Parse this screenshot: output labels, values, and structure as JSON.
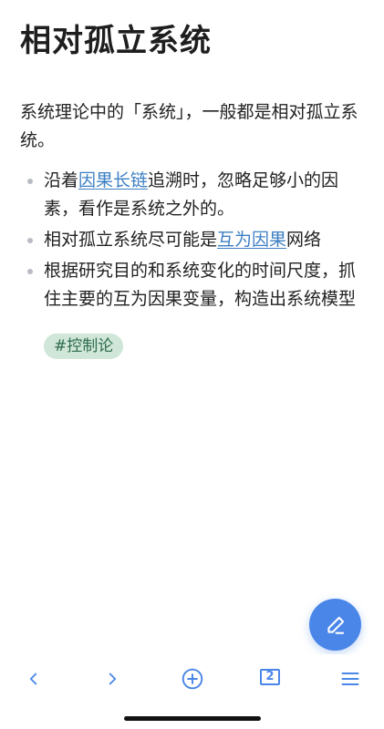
{
  "note": {
    "title": "相对孤立系统",
    "intro": "系统理论中的「系统」，一般都是相对孤立系统。",
    "bullets": [
      {
        "before": "沿着",
        "link": "因果长链",
        "after": "追溯时，忽略足够小的因素，看作是系统之外的。"
      },
      {
        "before": "相对孤立系统尽可能是",
        "link": "互为因果",
        "after": "网络"
      },
      {
        "before": "根据研究目的和系统变化的时间尺度，抓住主要的互为因果变量，构造出系统模型",
        "link": "",
        "after": ""
      }
    ],
    "tag": "#控制论"
  },
  "fab": {
    "icon": "pencil-icon"
  },
  "toolbar": {
    "back_icon": "chevron-left-icon",
    "forward_icon": "chevron-right-icon",
    "add_icon": "plus-circle-icon",
    "tab_count": "2",
    "menu_icon": "hamburger-menu-icon"
  },
  "colors": {
    "accent": "#4a86e8",
    "link": "#3d7fc4",
    "tag_bg": "#cfe6d8",
    "tag_text": "#2e6b4c"
  }
}
